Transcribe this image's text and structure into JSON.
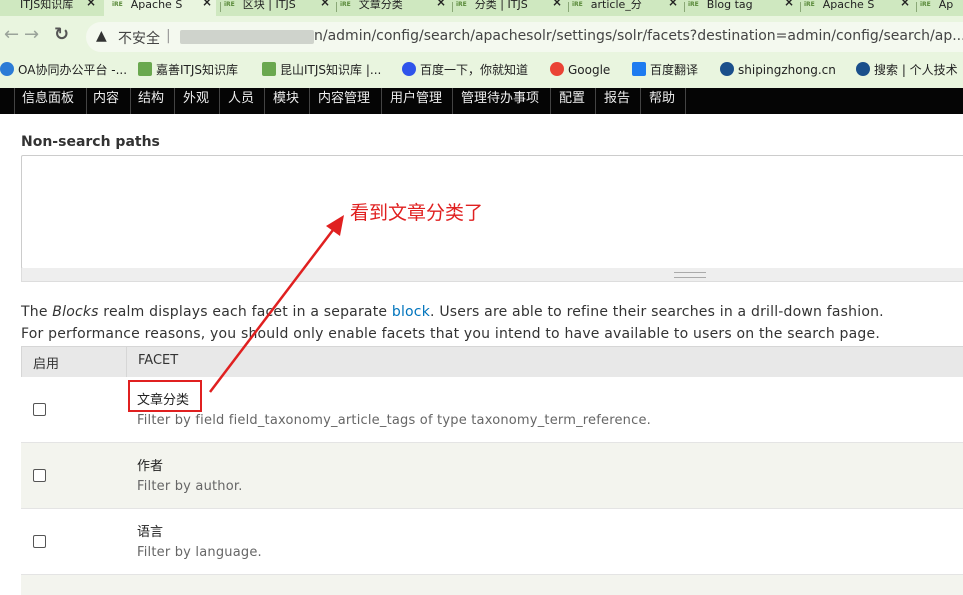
{
  "browser": {
    "tabs": [
      {
        "favicon": "",
        "title": "ITJS知识库"
      },
      {
        "favicon": "iRE",
        "title": "Apache S"
      },
      {
        "favicon": "iRE",
        "title": "区块 | ITJS"
      },
      {
        "favicon": "iRE",
        "title": "文章分类"
      },
      {
        "favicon": "iRE",
        "title": "分类 | ITJS"
      },
      {
        "favicon": "iRE",
        "title": "article_分"
      },
      {
        "favicon": "iRE",
        "title": "Blog tag"
      },
      {
        "favicon": "iRE",
        "title": "Apache S"
      },
      {
        "favicon": "iRE",
        "title": "Ap"
      }
    ],
    "close_glyph": "×",
    "nav": {
      "back": "←",
      "forward": "→",
      "reload": "↻"
    },
    "security_label": "不安全",
    "url_separator": "|",
    "url_visible": "n/admin/config/search/apachesolr/settings/solr/facets?destination=admin/config/search/ap...",
    "warning_glyph": "▲",
    "bookmarks": [
      {
        "label": "OA协同办公平台 -...",
        "color": "#2b7bd6"
      },
      {
        "label": "嘉善ITJS知识库",
        "color": "#6aa84f"
      },
      {
        "label": "昆山ITJS知识库 |...",
        "color": "#6aa84f"
      },
      {
        "label": "百度一下，你就知道",
        "color": "#2f54eb"
      },
      {
        "label": "Google",
        "color": "#ea4335"
      },
      {
        "label": "百度翻译",
        "color": "#1e7bf0"
      },
      {
        "label": "shipingzhong.cn",
        "color": "#1a4f8b"
      },
      {
        "label": "搜索 | 个人技术",
        "color": "#1a4f8b"
      }
    ]
  },
  "admin_menu": [
    "信息面板",
    "内容",
    "结构",
    "外观",
    "人员",
    "模块",
    "内容管理",
    "用户管理",
    "管理待办事项",
    "配置",
    "报告",
    "帮助"
  ],
  "content": {
    "non_search_label": "Non-search paths",
    "desc_line1": {
      "before": "The ",
      "em": "Blocks",
      "middle": " realm displays each facet in a separate ",
      "link": "block",
      "after": ". Users are able to refine their searches in a drill-down fashion."
    },
    "desc_line2": "For performance reasons, you should only enable facets that you intend to have available to users on the search page.",
    "table_headers": {
      "enabled": "启用",
      "facet": "FACET"
    },
    "facets": [
      {
        "name": "文章分类",
        "description": "Filter by field field_taxonomy_article_tags of type taxonomy_term_reference."
      },
      {
        "name": "作者",
        "description": "Filter by author."
      },
      {
        "name": "语言",
        "description": "Filter by language."
      }
    ]
  },
  "annotation": {
    "text": "看到文章分类了",
    "color": "#e02020"
  }
}
